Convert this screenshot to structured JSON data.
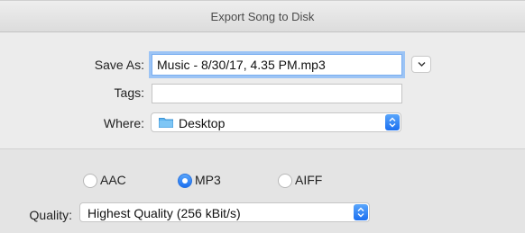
{
  "window": {
    "title": "Export Song to Disk"
  },
  "save_as": {
    "label": "Save As:",
    "value": "Music - 8/30/17, 4.35 PM.mp3"
  },
  "tags": {
    "label": "Tags:",
    "value": ""
  },
  "where": {
    "label": "Where:",
    "value": "Desktop"
  },
  "format": {
    "options": [
      {
        "label": "AAC",
        "selected": false
      },
      {
        "label": "MP3",
        "selected": true
      },
      {
        "label": "AIFF",
        "selected": false
      }
    ]
  },
  "quality": {
    "label": "Quality:",
    "value": "Highest Quality (256 kBit/s)"
  },
  "colors": {
    "accent": "#1b6ff0",
    "focus_ring": "#9cc4f5",
    "folder": "#5eb4ef"
  }
}
